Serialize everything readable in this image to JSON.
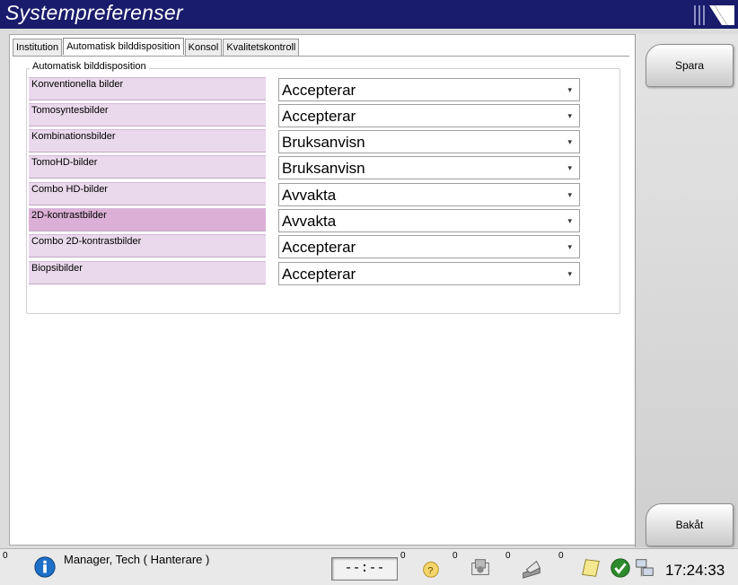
{
  "window": {
    "title": "Systempreferenser"
  },
  "tabs": [
    {
      "label": "Institution",
      "active": false
    },
    {
      "label": "Automatisk bilddisposition",
      "active": true
    },
    {
      "label": "Konsol",
      "active": false
    },
    {
      "label": "Kvalitetskontroll",
      "active": false
    }
  ],
  "group": {
    "label": "Automatisk bilddisposition"
  },
  "rows": [
    {
      "label": "Konventionella bilder",
      "value": "Accepterar"
    },
    {
      "label": "Tomosyntesbilder",
      "value": "Accepterar"
    },
    {
      "label": "Kombinationsbilder",
      "value": "Bruksanvisn"
    },
    {
      "label": "TomoHD-bilder",
      "value": "Bruksanvisn"
    },
    {
      "label": "Combo HD-bilder",
      "value": "Avvakta"
    },
    {
      "label": "2D-kontrastbilder",
      "value": "Avvakta"
    },
    {
      "label": "Combo 2D-kontrastbilder",
      "value": "Accepterar"
    },
    {
      "label": "Biopsibilder",
      "value": "Accepterar"
    }
  ],
  "rail": {
    "save_label": "Spara",
    "back_label": "Bakåt"
  },
  "status": {
    "info_count": "0",
    "user": "Manager, Tech ( Hanterare )",
    "timer": "--:--",
    "help_count": "0",
    "queue_count": "0",
    "print_count": "0",
    "output_count": "0",
    "clock": "17:24:33"
  },
  "colors": {
    "titlebar": "#191c6b",
    "label_bg": "#ead8ec",
    "label_bg_selected": "#dcb0d6"
  }
}
